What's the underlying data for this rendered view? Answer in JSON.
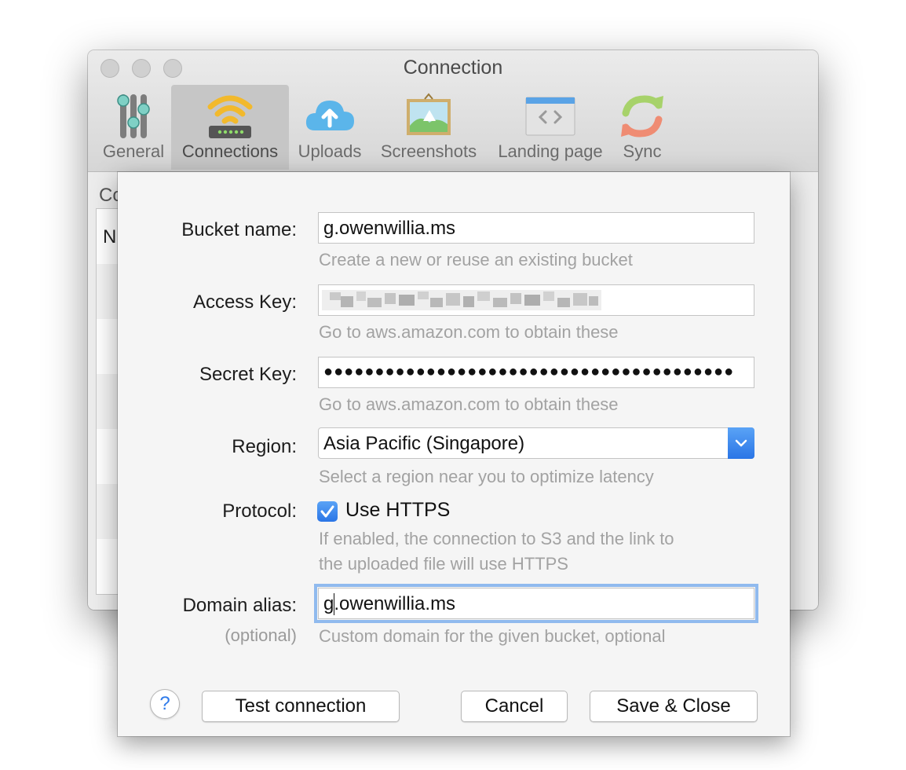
{
  "window": {
    "title": "Connection",
    "toolbar": [
      {
        "label": "General",
        "icon": "sliders-icon"
      },
      {
        "label": "Connections",
        "icon": "wifi-router-icon",
        "selected": true
      },
      {
        "label": "Uploads",
        "icon": "cloud-upload-icon"
      },
      {
        "label": "Screenshots",
        "icon": "picture-icon"
      },
      {
        "label": "Landing page",
        "icon": "code-window-icon"
      },
      {
        "label": "Sync",
        "icon": "sync-arrows-icon"
      }
    ],
    "background_label": "Co",
    "background_column": "N"
  },
  "form": {
    "bucket": {
      "label": "Bucket name:",
      "value": "g.owenwillia.ms",
      "hint": "Create a new or reuse an existing bucket"
    },
    "access_key": {
      "label": "Access Key:",
      "value_state": "redacted (pixelated)",
      "hint": "Go to aws.amazon.com to obtain these"
    },
    "secret_key": {
      "label": "Secret Key:",
      "value": "●●●●●●●●●●●●●●●●●●●●●●●●●●●●●●●●●●●●●●●●",
      "hint": "Go to aws.amazon.com to obtain these"
    },
    "region": {
      "label": "Region:",
      "value": "Asia Pacific (Singapore)",
      "hint": "Select a region near you to optimize latency"
    },
    "protocol": {
      "label": "Protocol:",
      "checkbox_label": "Use HTTPS",
      "checked": true,
      "hint_line1": "If enabled, the connection to S3 and the link to",
      "hint_line2": "the uploaded file will use HTTPS"
    },
    "domain_alias": {
      "label": "Domain alias:",
      "sublabel": "(optional)",
      "value": "g.owenwillia.ms",
      "hint": "Custom domain for the given bucket, optional"
    }
  },
  "buttons": {
    "help": "?",
    "test": "Test connection",
    "cancel": "Cancel",
    "save": "Save & Close"
  },
  "colors": {
    "accent": "#2f7bea",
    "hint_text": "#a2a2a2",
    "sheet_bg": "#f5f5f5"
  }
}
